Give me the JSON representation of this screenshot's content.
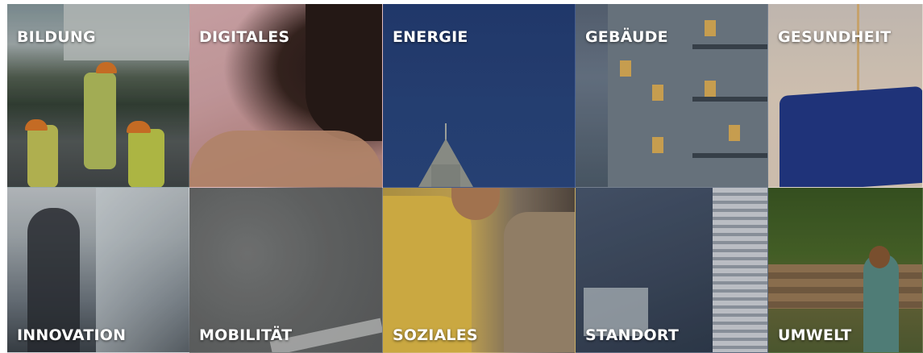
{
  "tiles": {
    "row1": [
      {
        "label": "BILDUNG"
      },
      {
        "label": "DIGITALES"
      },
      {
        "label": "ENERGIE"
      },
      {
        "label": "GEBÄUDE"
      },
      {
        "label": "GESUNDHEIT"
      }
    ],
    "row2": [
      {
        "label": "INNOVATION"
      },
      {
        "label": "MOBILITÄT"
      },
      {
        "label": "SOZIALES"
      },
      {
        "label": "STANDORT"
      },
      {
        "label": "UMWELT"
      }
    ]
  },
  "colors": {
    "label_text": "#ffffff",
    "energie_tile": "#2a4780"
  }
}
